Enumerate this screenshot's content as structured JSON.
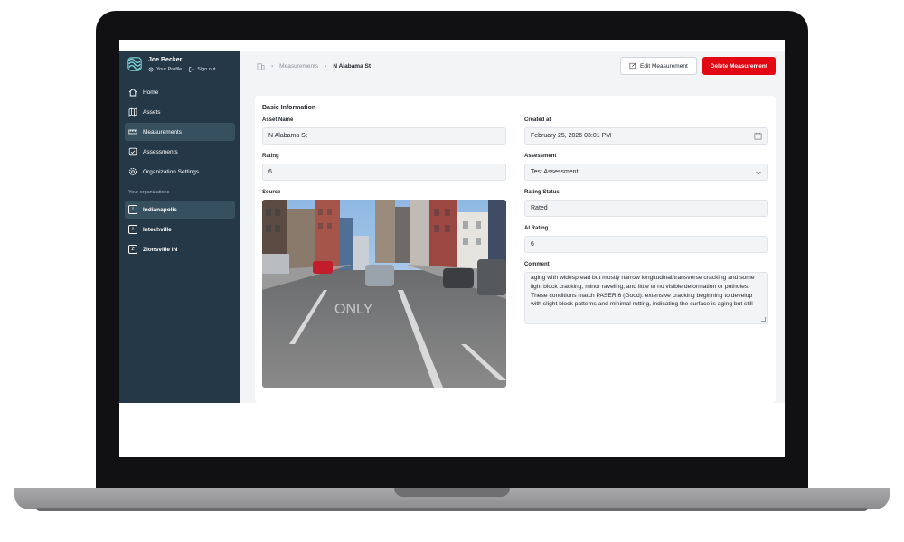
{
  "user": {
    "name": "Joe Becker",
    "profile_label": "Your Profile",
    "signout_label": "Sign out"
  },
  "nav": [
    {
      "label": "Home",
      "icon": "home-icon"
    },
    {
      "label": "Assets",
      "icon": "map-icon"
    },
    {
      "label": "Measurements",
      "icon": "ruler-icon",
      "active": true
    },
    {
      "label": "Assessments",
      "icon": "clipboard-check-icon"
    },
    {
      "label": "Organization Settings",
      "icon": "gear-icon"
    }
  ],
  "orgs_heading": "Your organizations",
  "orgs": [
    {
      "badge": "I",
      "label": "Indianapolis",
      "active": true
    },
    {
      "badge": "I",
      "label": "Intechville"
    },
    {
      "badge": "Z",
      "label": "Zionsville IN"
    }
  ],
  "breadcrumb": {
    "parent": "Measurements",
    "current": "N Alabama St"
  },
  "actions": {
    "edit_label": "Edit Measurement",
    "delete_label": "Delete Measurement"
  },
  "form": {
    "section_title": "Basic Information",
    "asset_name": {
      "label": "Asset Name",
      "value": "N Alabama St"
    },
    "rating": {
      "label": "Rating",
      "value": "6"
    },
    "source_label": "Source",
    "created_at": {
      "label": "Created at",
      "value": "February 25, 2026 03:01 PM"
    },
    "assessment": {
      "label": "Assessment",
      "value": "Test Assessment"
    },
    "rating_status": {
      "label": "Rating Status",
      "value": "Rated"
    },
    "ai_rating": {
      "label": "AI Rating",
      "value": "6"
    },
    "comment": {
      "label": "Comment",
      "value": "aging with widespread but mostly narrow longitudinal/transverse cracking and some light block cracking, minor raveling, and little to no visible deformation or potholes. These conditions match PASER 6 (Good): extensive cracking beginning to develop with slight block patterns and minimal rutting, indicating the surface is aging but still"
    }
  },
  "photo": {
    "road_marking": "ONLY"
  },
  "colors": {
    "sidebar": "#243847",
    "active_item": "#36505f",
    "danger": "#e30613"
  }
}
